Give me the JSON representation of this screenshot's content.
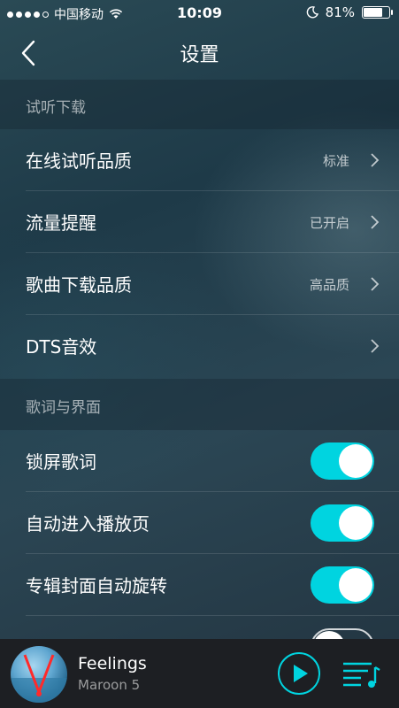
{
  "status_bar": {
    "carrier": "中国移动",
    "time": "10:09",
    "battery_percent": "81%",
    "battery_level": 0.81
  },
  "nav": {
    "title": "设置",
    "back_icon": "chevron-left-icon"
  },
  "sections": [
    {
      "header": "试听下载",
      "rows": [
        {
          "label": "在线试听品质",
          "value": "标准"
        },
        {
          "label": "流量提醒",
          "value": "已开启"
        },
        {
          "label": "歌曲下载品质",
          "value": "高品质"
        },
        {
          "label": "DTS音效",
          "value": ""
        }
      ]
    },
    {
      "header": "歌词与界面",
      "toggles": [
        {
          "label": "锁屏歌词",
          "on": true
        },
        {
          "label": "自动进入播放页",
          "on": true
        },
        {
          "label": "专辑封面自动旋转",
          "on": true
        },
        {
          "label": "",
          "on": false
        }
      ]
    }
  ],
  "player": {
    "title": "Feelings",
    "artist": "Maroon 5",
    "play_icon": "play-icon",
    "playlist_icon": "playlist-music-icon"
  },
  "colors": {
    "accent": "#00d4e0",
    "player_bg": "#1d1f23"
  }
}
